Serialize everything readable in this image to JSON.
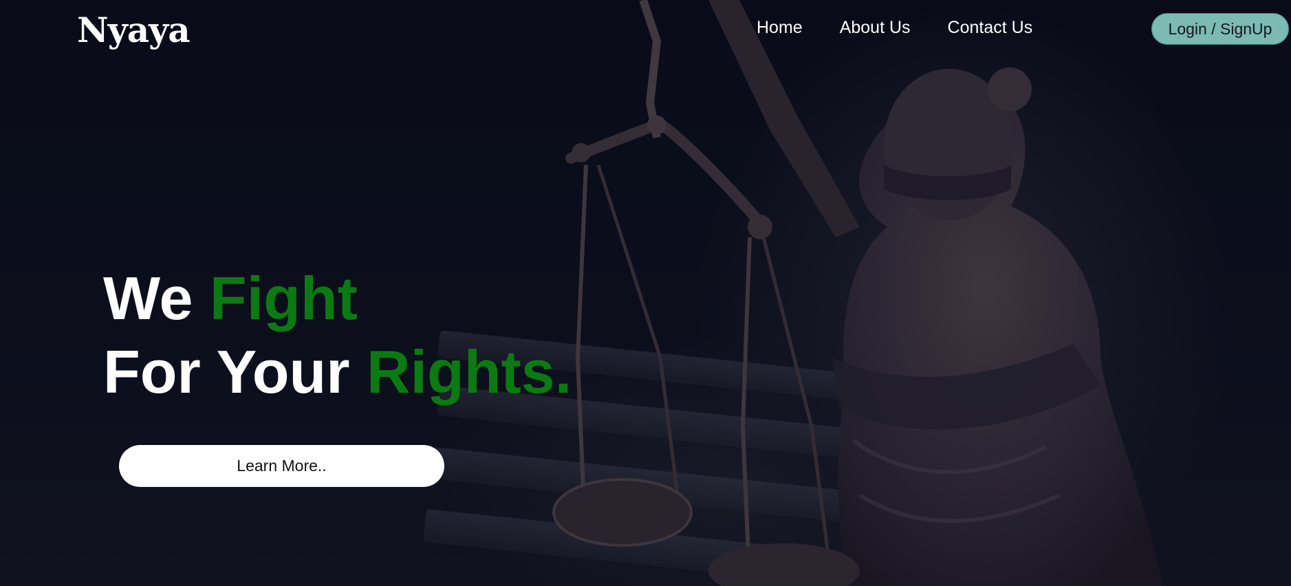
{
  "brand": {
    "name": "Nyaya"
  },
  "nav": {
    "items": [
      {
        "label": "Home"
      },
      {
        "label": "About Us"
      },
      {
        "label": "Contact Us"
      }
    ],
    "login_label": "Login / SignUp"
  },
  "hero": {
    "line1_white": "We ",
    "line1_accent": "Fight",
    "line2_white": "For Your ",
    "line2_accent": "Rights.",
    "cta_label": "Learn More.."
  },
  "colors": {
    "background": "#0b0d1a",
    "accent": "#0b7a12",
    "login_bg": "#7cbab4",
    "cta_bg": "#ffffff"
  },
  "background_image": {
    "subject": "lady-justice-statue-with-scales"
  }
}
